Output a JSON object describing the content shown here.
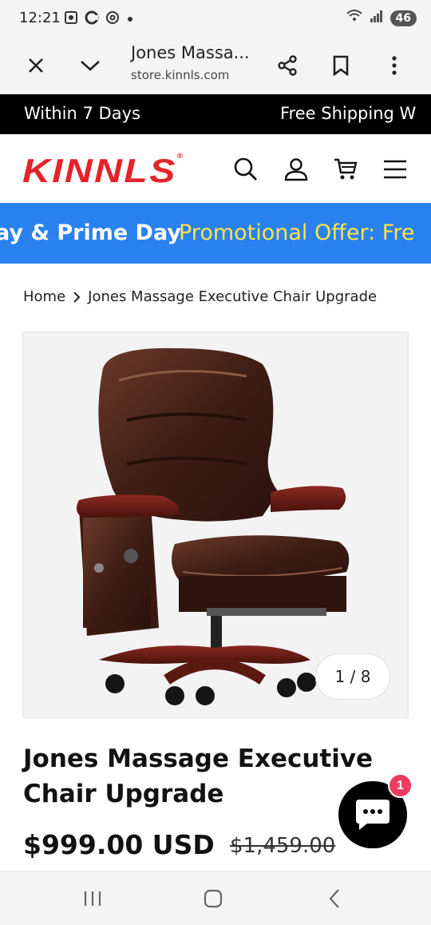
{
  "status_bar": {
    "time": "12:21",
    "battery": "46",
    "left_icons": [
      "screenshot-icon",
      "c-app-icon",
      "threads-icon",
      "dot-icon"
    ],
    "right_icons": [
      "wifi-icon",
      "signal-icon"
    ]
  },
  "browser": {
    "page_title": "Jones Massa...",
    "url": "store.kinnls.com"
  },
  "announcement": {
    "left_text": "Within 7 Days",
    "right_text": "Free Shipping W"
  },
  "header": {
    "logo_text": "KINNLS",
    "logo_mark": "®"
  },
  "promo": {
    "text_a": "ay & Prime Day",
    "text_b": "Promotional Offer: Fre"
  },
  "breadcrumb": {
    "home": "Home",
    "current": "Jones Massage Executive Chair Upgrade"
  },
  "media": {
    "counter": "1 / 8"
  },
  "product": {
    "title": "Jones Massage Executive Chair Upgrade",
    "price": "$999.00 USD",
    "compare_price": "$1,459.00"
  },
  "chat": {
    "badge": "1"
  },
  "colors": {
    "brand_red": "#e4232a",
    "promo_blue": "#2a82f0",
    "promo_yellow": "#ffe24a",
    "chat_badge": "#ee3a5e"
  }
}
